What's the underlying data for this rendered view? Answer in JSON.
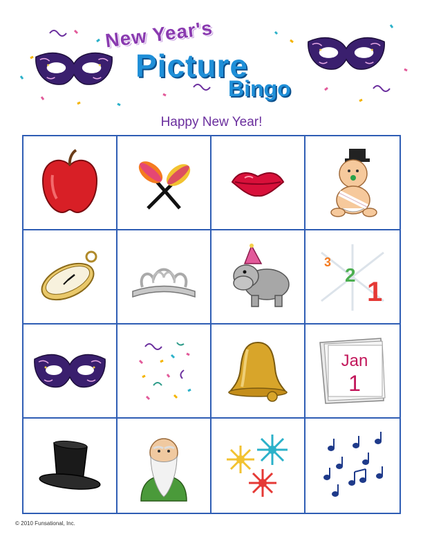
{
  "header": {
    "title_line1": "New Year's",
    "title_line2": "Picture",
    "title_line3": "Bingo",
    "subtitle": "Happy New Year!"
  },
  "card": {
    "cells": [
      {
        "icon": "apple-icon"
      },
      {
        "icon": "maracas-icon"
      },
      {
        "icon": "lips-icon"
      },
      {
        "icon": "baby-new-year-icon"
      },
      {
        "icon": "pocket-watch-icon"
      },
      {
        "icon": "tiara-icon"
      },
      {
        "icon": "hippo-party-hat-icon"
      },
      {
        "icon": "countdown-icon",
        "text": [
          "3",
          "2",
          "1"
        ]
      },
      {
        "icon": "masquerade-mask-icon"
      },
      {
        "icon": "confetti-icon"
      },
      {
        "icon": "bell-icon"
      },
      {
        "icon": "calendar-icon",
        "text": [
          "Jan",
          "1"
        ]
      },
      {
        "icon": "top-hat-icon"
      },
      {
        "icon": "father-time-icon"
      },
      {
        "icon": "fireworks-icon"
      },
      {
        "icon": "music-notes-icon"
      }
    ]
  },
  "footer": {
    "copyright": "© 2010 Funsational, Inc."
  },
  "colors": {
    "grid_border": "#2e5db4",
    "subtitle": "#6b2f9e",
    "title_blue": "#1f8fd8",
    "title_purple": "#8a3ab0"
  }
}
